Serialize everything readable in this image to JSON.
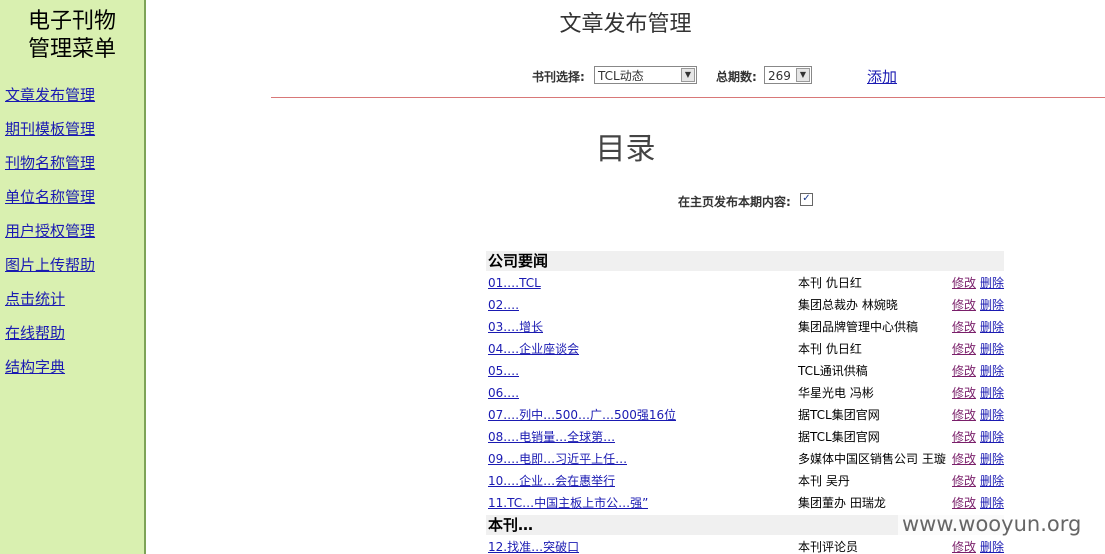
{
  "sidebar": {
    "title_line1": "电子刊物",
    "title_line2": "管理菜单",
    "items": [
      {
        "label": "文章发布管理"
      },
      {
        "label": "期刊模板管理"
      },
      {
        "label": "刊物名称管理"
      },
      {
        "label": "单位名称管理"
      },
      {
        "label": "用户授权管理"
      },
      {
        "label": "图片上传帮助"
      },
      {
        "label": "点击统计"
      },
      {
        "label": "在线帮助"
      },
      {
        "label": "结构字典"
      }
    ]
  },
  "header": {
    "title": "文章发布管理",
    "journal_label": "书刊选择:",
    "journal_value": "TCL动态",
    "issue_label": "总期数:",
    "issue_value": "269",
    "add_label": "添加"
  },
  "toc": {
    "title": "目录",
    "publish_label": "在主页发布本期内容:",
    "publish_checked": true
  },
  "sections": [
    {
      "name": "公司要闻",
      "articles": [
        {
          "title": "01.…TCL",
          "author": "本刊 仇日红"
        },
        {
          "title": "02.…",
          "author": "集团总裁办 林婉晓"
        },
        {
          "title": "03.…增长",
          "author": "集团品牌管理中心供稿"
        },
        {
          "title": "04.…企业座谈会",
          "author": "本刊 仇日红"
        },
        {
          "title": "05.…",
          "author": "TCL通讯供稿"
        },
        {
          "title": "06.…",
          "author": "华星光电 冯彬"
        },
        {
          "title": "07.…列中…500…广…500强16位",
          "author": "据TCL集团官网"
        },
        {
          "title": "08.…电销量…全球第…",
          "author": "据TCL集团官网"
        },
        {
          "title": "09.…电即…习近平上任…",
          "author": "多媒体中国区销售公司 王璇"
        },
        {
          "title": "10.…企业…会在惠举行",
          "author": "本刊 吴丹"
        },
        {
          "title": "11.TC…中国主板上市公…强”",
          "author": "集团董办 田瑞龙"
        }
      ]
    },
    {
      "name": "本刊…",
      "articles": [
        {
          "title": "12.找准…突破口",
          "author": "本刊评论员"
        }
      ]
    }
  ],
  "row_actions": {
    "edit": "修改",
    "delete": "删除"
  },
  "watermark": "www.wooyun.org"
}
